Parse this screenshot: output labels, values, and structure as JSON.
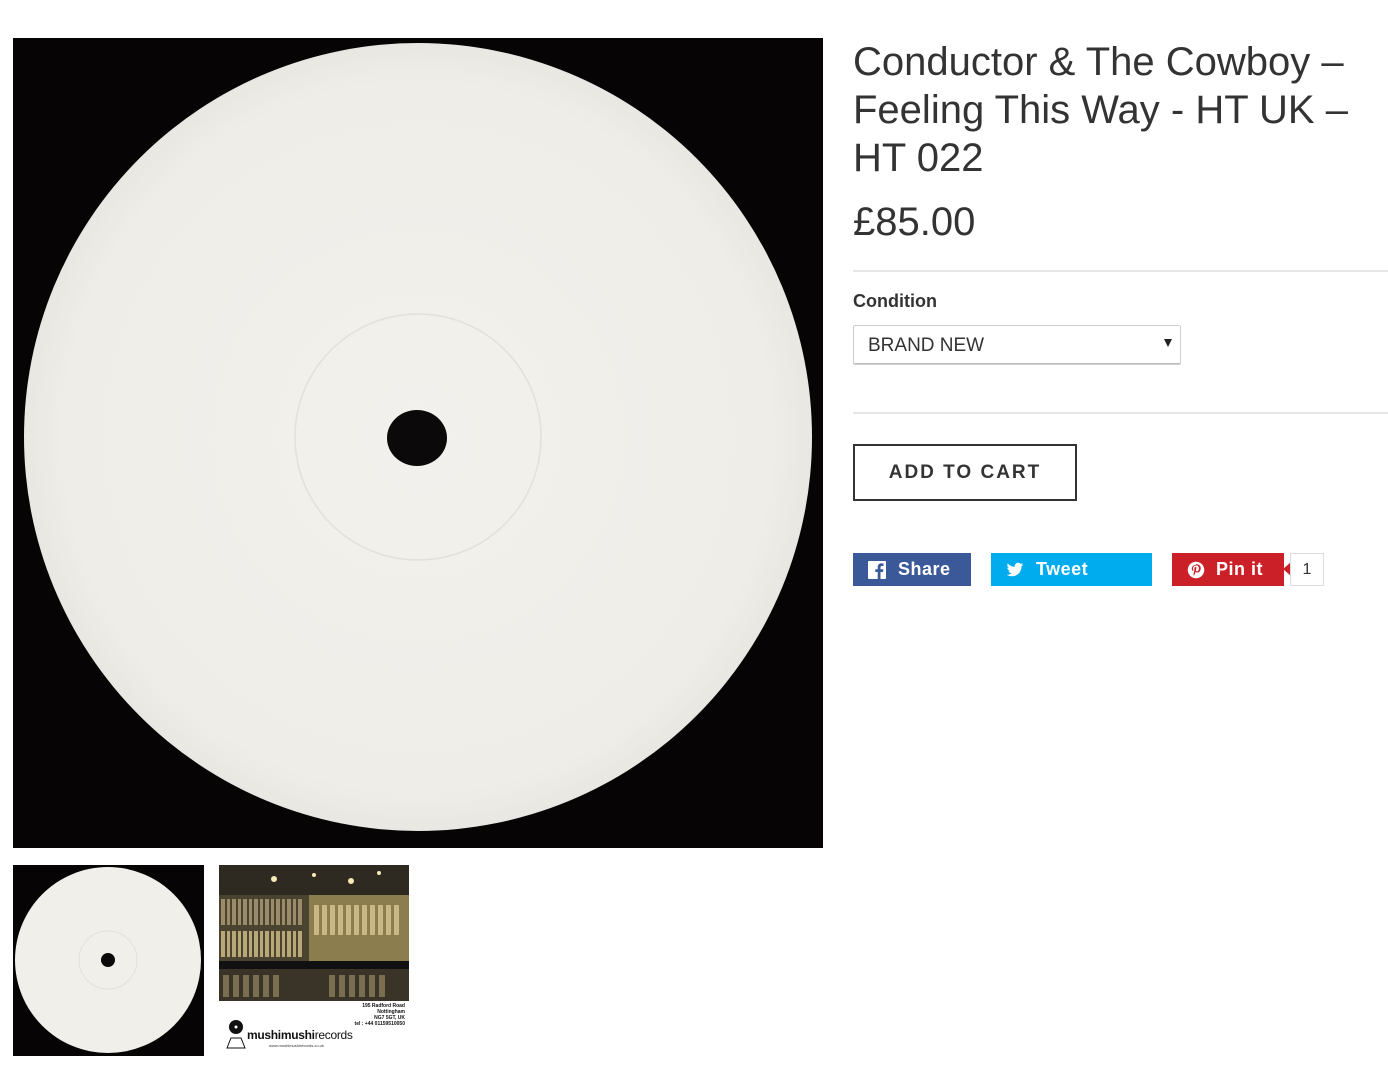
{
  "product": {
    "title": "Conductor & The Cowboy – Feeling This Way - HT UK – HT 022",
    "price": "£85.00",
    "image_alt": "White label vinyl record",
    "thumbnails": [
      {
        "name": "White label vinyl record"
      },
      {
        "name": "Mushi Mushi Records shop card"
      }
    ]
  },
  "shop_card": {
    "address_lines": [
      "195 Radford Road",
      "Nottingham",
      "NG7 5GT, UK",
      "tel : +44 01159510050"
    ],
    "logo_name_bold": "mushimushi",
    "logo_name_rest": "records",
    "website": "www.mushimushirecords.co.uk"
  },
  "condition": {
    "label": "Condition",
    "selected": "BRAND NEW"
  },
  "cart": {
    "add_label": "ADD TO CART"
  },
  "social": {
    "share_label": "Share",
    "tweet_label": "Tweet",
    "pin_label": "Pin it",
    "pin_count": "1",
    "colors": {
      "facebook": "#3b5998",
      "twitter": "#00aced",
      "pinterest": "#cb2027"
    },
    "icons": [
      "facebook-icon",
      "twitter-icon",
      "pinterest-icon"
    ]
  }
}
